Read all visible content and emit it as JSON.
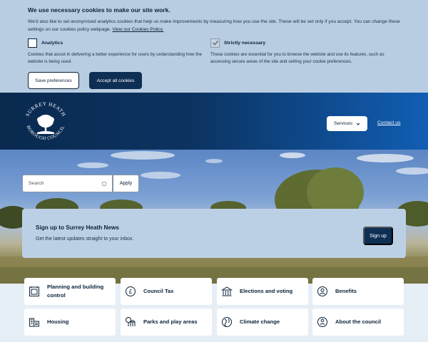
{
  "cookie": {
    "title": "We use necessary cookies to make our site work.",
    "intro": "We'd also like to set anonymised analytics cookies that help us make improvements by measuring how you use the site. These will be set only if you accept. You can change these settings on our cookies policy webpage.",
    "policy_link": "View our Cookies Policy.",
    "analytics": {
      "label": "Analytics",
      "desc": "Cookies that assist in delivering a better experience for users by understanding how the website is being used.",
      "checked": false
    },
    "necessary": {
      "label": "Strictly necessary",
      "desc": "These cookies are essential for you to browse the website and use its features, such as accessing secure areas of the site and setting your cookie preferences.",
      "checked": true
    },
    "save_label": "Save preferences",
    "accept_label": "Accept all cookies"
  },
  "header": {
    "logo_text": "SURREY HEATH BOROUGH COUNCIL",
    "services_label": "Services",
    "contact_label": "Contact us"
  },
  "search": {
    "placeholder": "Search",
    "apply_label": "Apply"
  },
  "signup": {
    "title": "Sign up to Surrey Heath News",
    "text": "Get the latest updates straight to your inbox.",
    "button": "Sign up"
  },
  "cards": [
    {
      "label": "Planning and building control",
      "icon": "planning-icon"
    },
    {
      "label": "Council Tax",
      "icon": "pound-coin-icon"
    },
    {
      "label": "Elections and voting",
      "icon": "building-columns-icon"
    },
    {
      "label": "Benefits",
      "icon": "person-icon"
    },
    {
      "label": "Housing",
      "icon": "housing-icon"
    },
    {
      "label": "Parks and play areas",
      "icon": "park-icon"
    },
    {
      "label": "Climate change",
      "icon": "globe-leaf-icon"
    },
    {
      "label": "About the council",
      "icon": "info-person-icon"
    }
  ],
  "colors": {
    "navy": "#0e2f54",
    "banner": "#b9cde2",
    "header_start": "#0a2a4f",
    "header_end": "#115eb3"
  }
}
